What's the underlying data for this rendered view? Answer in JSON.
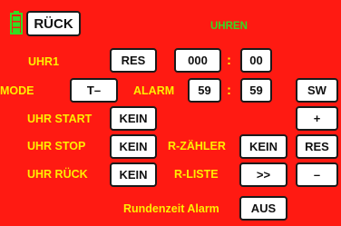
{
  "header": {
    "back_label": "RÜCK",
    "title": "UHREN",
    "battery_icon": "battery-icon"
  },
  "clock": {
    "label": "UHR1",
    "reset_label": "RES",
    "minutes": "000",
    "separator": ":",
    "seconds": "00"
  },
  "mode": {
    "label": "MODE",
    "value": "T–"
  },
  "alarm": {
    "label": "ALARM",
    "minutes": "59",
    "separator": ":",
    "seconds": "59"
  },
  "start": {
    "label": "UHR START",
    "value": "KEIN"
  },
  "stop": {
    "label": "UHR STOP",
    "value": "KEIN"
  },
  "counter": {
    "label": "R-ZÄHLER",
    "value": "KEIN"
  },
  "back": {
    "label": "UHR RÜCK",
    "value": "KEIN"
  },
  "list": {
    "label": "R-LISTE",
    "value": ">>"
  },
  "lap_alarm": {
    "label": "Rundenzeit Alarm",
    "value": "AUS"
  },
  "side": {
    "sw_label": "SW",
    "plus_label": "+",
    "res_label": "RES",
    "minus_label": "–"
  },
  "colors": {
    "background": "#ff1a12",
    "label": "#ffee00",
    "title": "#33dd22",
    "button": "#ffffff"
  }
}
